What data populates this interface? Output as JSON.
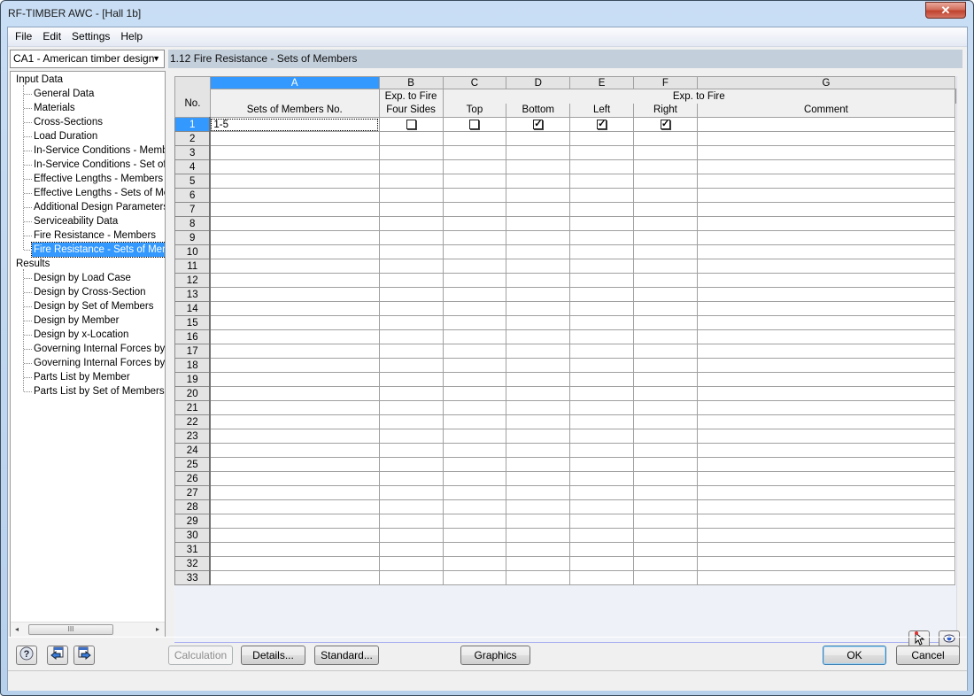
{
  "window": {
    "title": "RF-TIMBER AWC - [Hall 1b]",
    "close_glyph": "✕"
  },
  "menu": [
    "File",
    "Edit",
    "Settings",
    "Help"
  ],
  "case_selector": {
    "value": "CA1 - American timber design",
    "arrow": "▼"
  },
  "navigator": {
    "input_label": "Input Data",
    "input_items": [
      "General Data",
      "Materials",
      "Cross-Sections",
      "Load Duration",
      "In-Service Conditions - Members",
      "In-Service Conditions - Set of Members",
      "Effective Lengths - Members",
      "Effective Lengths - Sets of Members",
      "Additional Design Parameters",
      "Serviceability Data",
      "Fire Resistance - Members",
      "Fire Resistance - Sets of Members"
    ],
    "selected": "Fire Resistance - Sets of Members",
    "results_label": "Results",
    "results_items": [
      "Design by Load Case",
      "Design by Cross-Section",
      "Design by Set of Members",
      "Design by Member",
      "Design by x-Location",
      "Governing Internal Forces by Member",
      "Governing Internal Forces by Set of Members",
      "Parts List by Member",
      "Parts List by Set of Members"
    ],
    "scroll_left": "◂",
    "scroll_right": "▸",
    "scroll_thumb": "III"
  },
  "panel": {
    "title": "1.12 Fire Resistance - Sets of Members"
  },
  "table": {
    "column_letters": [
      "A",
      "B",
      "C",
      "D",
      "E",
      "F",
      "G"
    ],
    "no_header": "No.",
    "group_b": "Exp. to Fire",
    "group_cf": "Exp. to Fire",
    "headers": [
      "Sets of Members No.",
      "Four Sides",
      "Top",
      "Bottom",
      "Left",
      "Right",
      "Comment"
    ],
    "row_count": 33,
    "rows": [
      {
        "no": "1",
        "sets": "1-5",
        "four_sides": false,
        "top": false,
        "bottom": true,
        "left": true,
        "right": true,
        "comment": ""
      }
    ]
  },
  "panel_icons": {
    "pick": "pick-icon",
    "view": "view-icon"
  },
  "footer": {
    "calculation": "Calculation",
    "details": "Details...",
    "standard": "Standard...",
    "graphics": "Graphics",
    "ok": "OK",
    "cancel": "Cancel"
  }
}
